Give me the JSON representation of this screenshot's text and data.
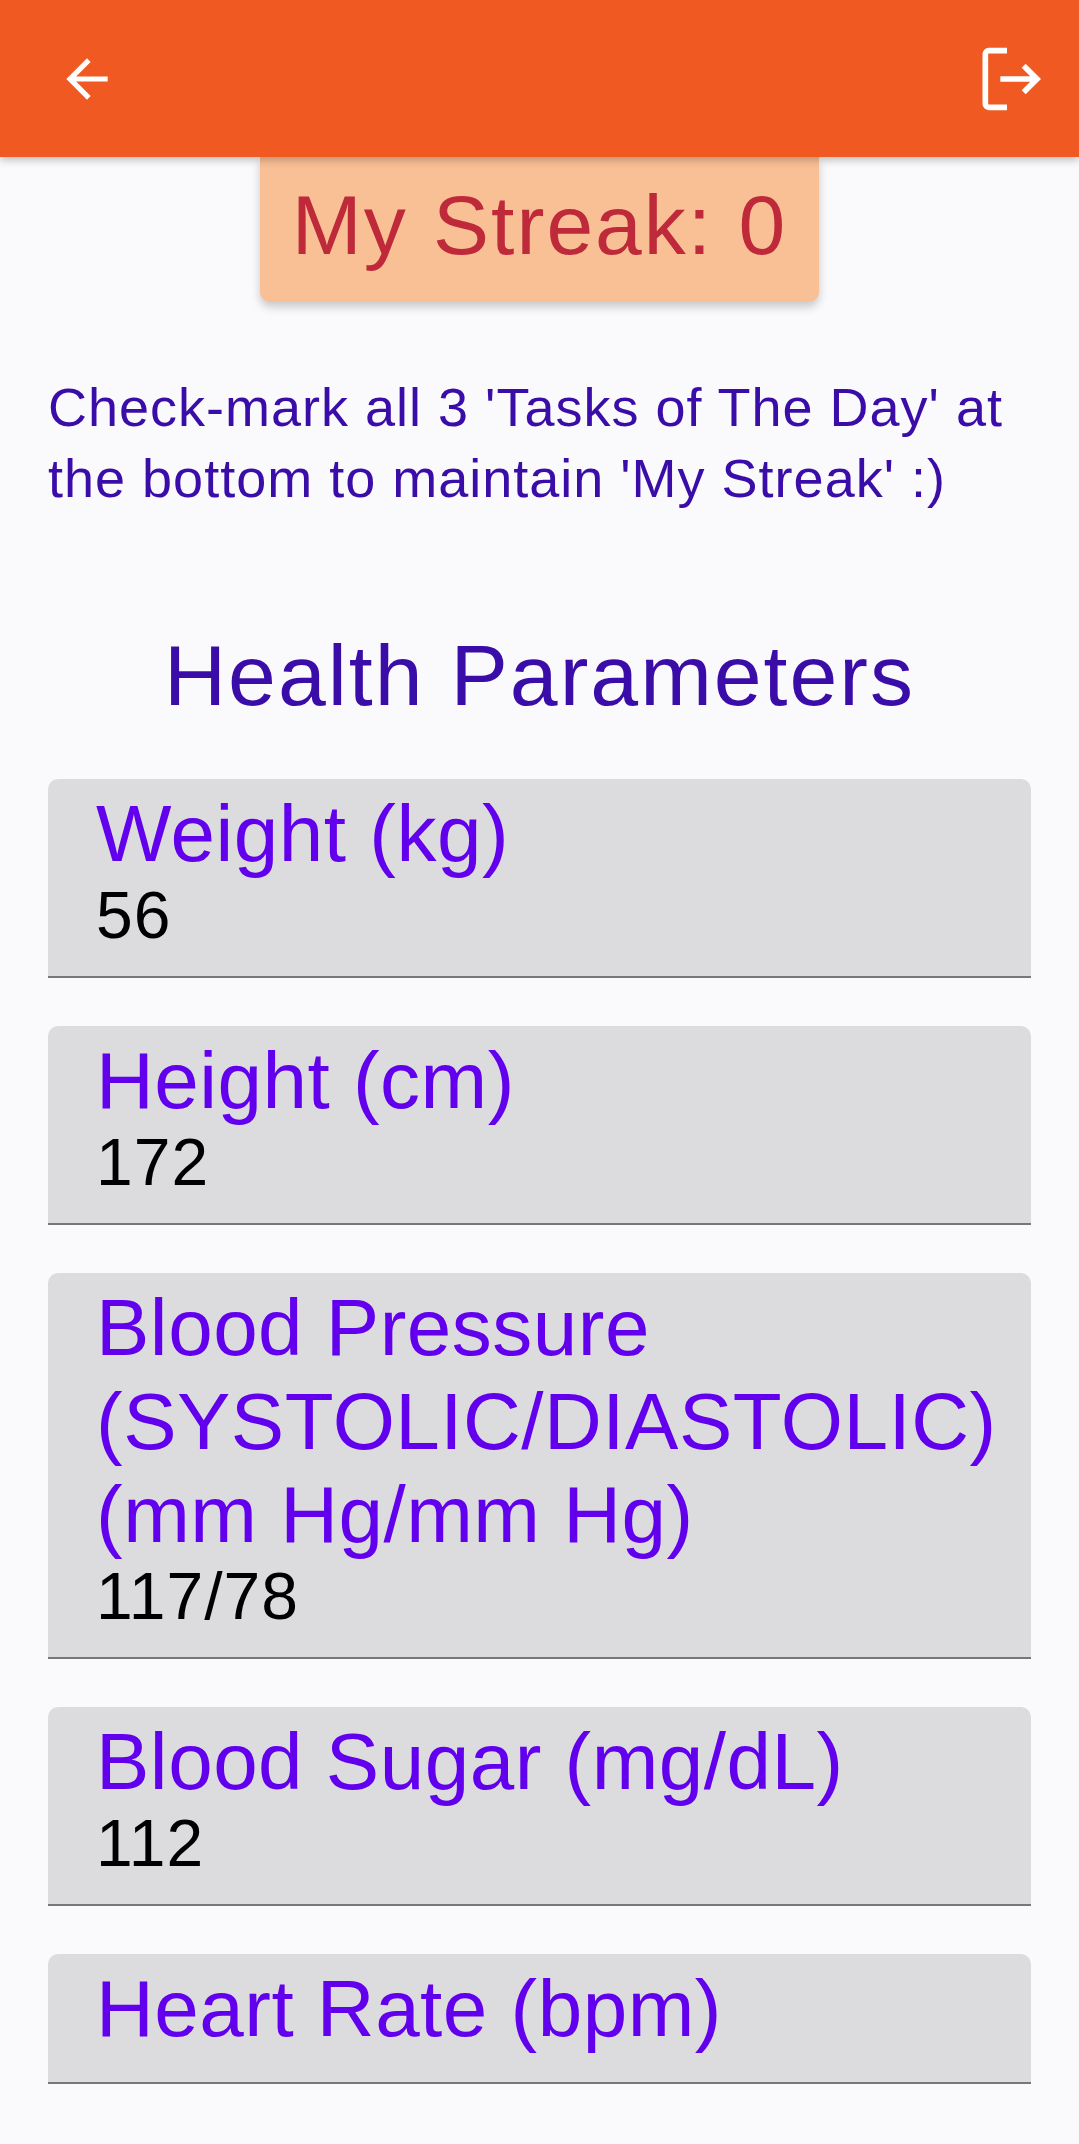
{
  "streak": {
    "text": "My Streak: 0"
  },
  "instructions": "Check-mark all 3 'Tasks of The Day' at the bottom to maintain 'My Streak' :)",
  "section_title": "Health Parameters",
  "fields": [
    {
      "label": "Weight (kg)",
      "value": "56"
    },
    {
      "label": "Height (cm)",
      "value": "172"
    },
    {
      "label": "Blood Pressure (SYSTOLIC/DIASTOLIC) (mm Hg/mm Hg)",
      "value": "117/78"
    },
    {
      "label": "Blood Sugar (mg/dL)",
      "value": "112"
    },
    {
      "label": "Heart Rate (bpm)"
    }
  ]
}
